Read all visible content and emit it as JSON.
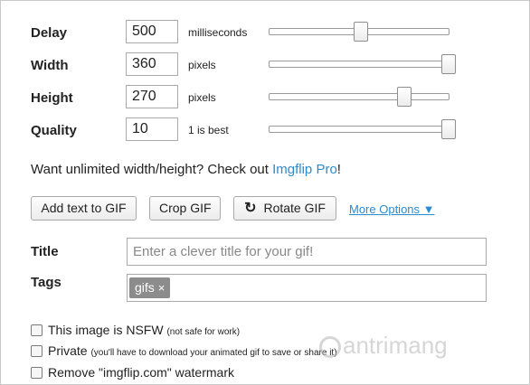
{
  "settings": [
    {
      "label": "Delay",
      "value": "500",
      "unit": "milliseconds",
      "slider_fraction": 0.49
    },
    {
      "label": "Width",
      "value": "360",
      "unit": "pixels",
      "slider_fraction": 1.0
    },
    {
      "label": "Height",
      "value": "270",
      "unit": "pixels",
      "slider_fraction": 0.74
    },
    {
      "label": "Quality",
      "value": "10",
      "unit": "1 is best",
      "slider_fraction": 1.0
    }
  ],
  "promo": {
    "text": "Want unlimited width/height? Check out ",
    "link": "Imgflip Pro",
    "suffix": "!"
  },
  "actions": {
    "add_text": "Add text to GIF",
    "crop": "Crop GIF",
    "rotate": "Rotate GIF",
    "more_options": "More Options ▼"
  },
  "title_field": {
    "label": "Title",
    "placeholder": "Enter a clever title for your gif!"
  },
  "tags_field": {
    "label": "Tags",
    "tags": [
      {
        "text": "gifs",
        "remove": "×"
      }
    ]
  },
  "checkboxes": [
    {
      "label": "This image is NSFW",
      "note": "(not safe for work)",
      "checked": false
    },
    {
      "label": "Private",
      "note": "(you'll have to download your animated gif to save or share it)",
      "checked": false
    },
    {
      "label": "Remove \"imgflip.com\" watermark",
      "note": "",
      "checked": false
    }
  ],
  "watermark": {
    "text": "antrimang"
  },
  "colors": {
    "link": "#2a8bd0",
    "tag_chip": "#8c8c8c",
    "border": "#a9a9a9"
  },
  "icons": {
    "rotate": "rotate-icon"
  }
}
